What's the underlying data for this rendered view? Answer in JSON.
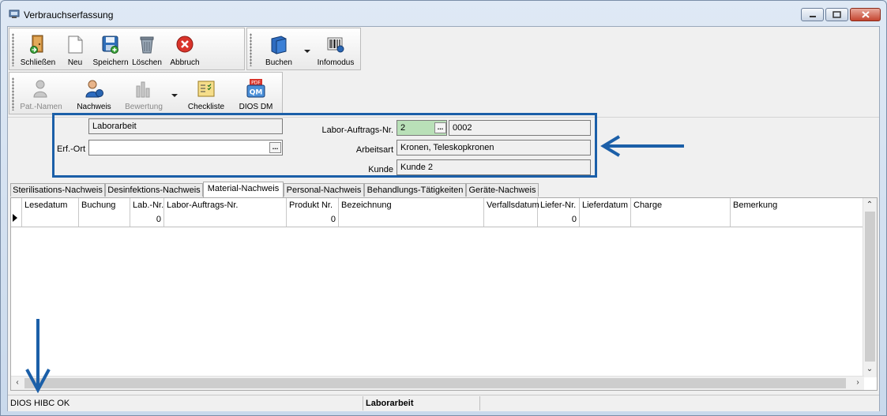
{
  "window": {
    "title": "Verbrauchserfassung"
  },
  "toolbar1": {
    "schliessen": "Schließen",
    "neu": "Neu",
    "speichern": "Speichern",
    "loeschen": "Löschen",
    "abbruch": "Abbruch",
    "buchen": "Buchen",
    "infomodus": "Infomodus"
  },
  "toolbar2": {
    "pat_namen": "Pat.-Namen",
    "nachweis": "Nachweis",
    "bewertung": "Bewertung",
    "checkliste": "Checkliste",
    "dios_dm": "DIOS DM"
  },
  "form": {
    "laborarbeit": "Laborarbeit",
    "erf_ort_label": "Erf.-Ort",
    "erf_ort_value": "",
    "labor_auftrags_label": "Labor-Auftrags-Nr.",
    "labor_auftrags_value": "2",
    "labor_auftrags_code": "0002",
    "arbeitsart_label": "Arbeitsart",
    "arbeitsart_value": "Kronen, Teleskopkronen",
    "kunde_label": "Kunde",
    "kunde_value": "Kunde 2",
    "ellipsis": "..."
  },
  "tabs": [
    {
      "label": "Sterilisations-Nachweis"
    },
    {
      "label": "Desinfektions-Nachweis"
    },
    {
      "label": "Material-Nachweis"
    },
    {
      "label": "Personal-Nachweis"
    },
    {
      "label": "Behandlungs-Tätigkeiten"
    },
    {
      "label": "Geräte-Nachweis"
    }
  ],
  "grid": {
    "columns": [
      "Lesedatum",
      "Buchung",
      "Lab.-Nr.",
      "Labor-Auftrags-Nr.",
      "Produkt Nr.",
      "Bezeichnung",
      "Verfallsdatum",
      "Liefer-Nr.",
      "Lieferdatum",
      "Charge",
      "Bemerkung"
    ],
    "row": {
      "lab_nr": "0",
      "produkt_nr": "0",
      "liefer_nr": "0"
    }
  },
  "status": {
    "left": "DIOS HIBC OK",
    "middle": "Laborarbeit",
    "right": ""
  },
  "colors": {
    "accent_arrow": "#1b5fa8",
    "field_green": "#b9e0b8"
  }
}
